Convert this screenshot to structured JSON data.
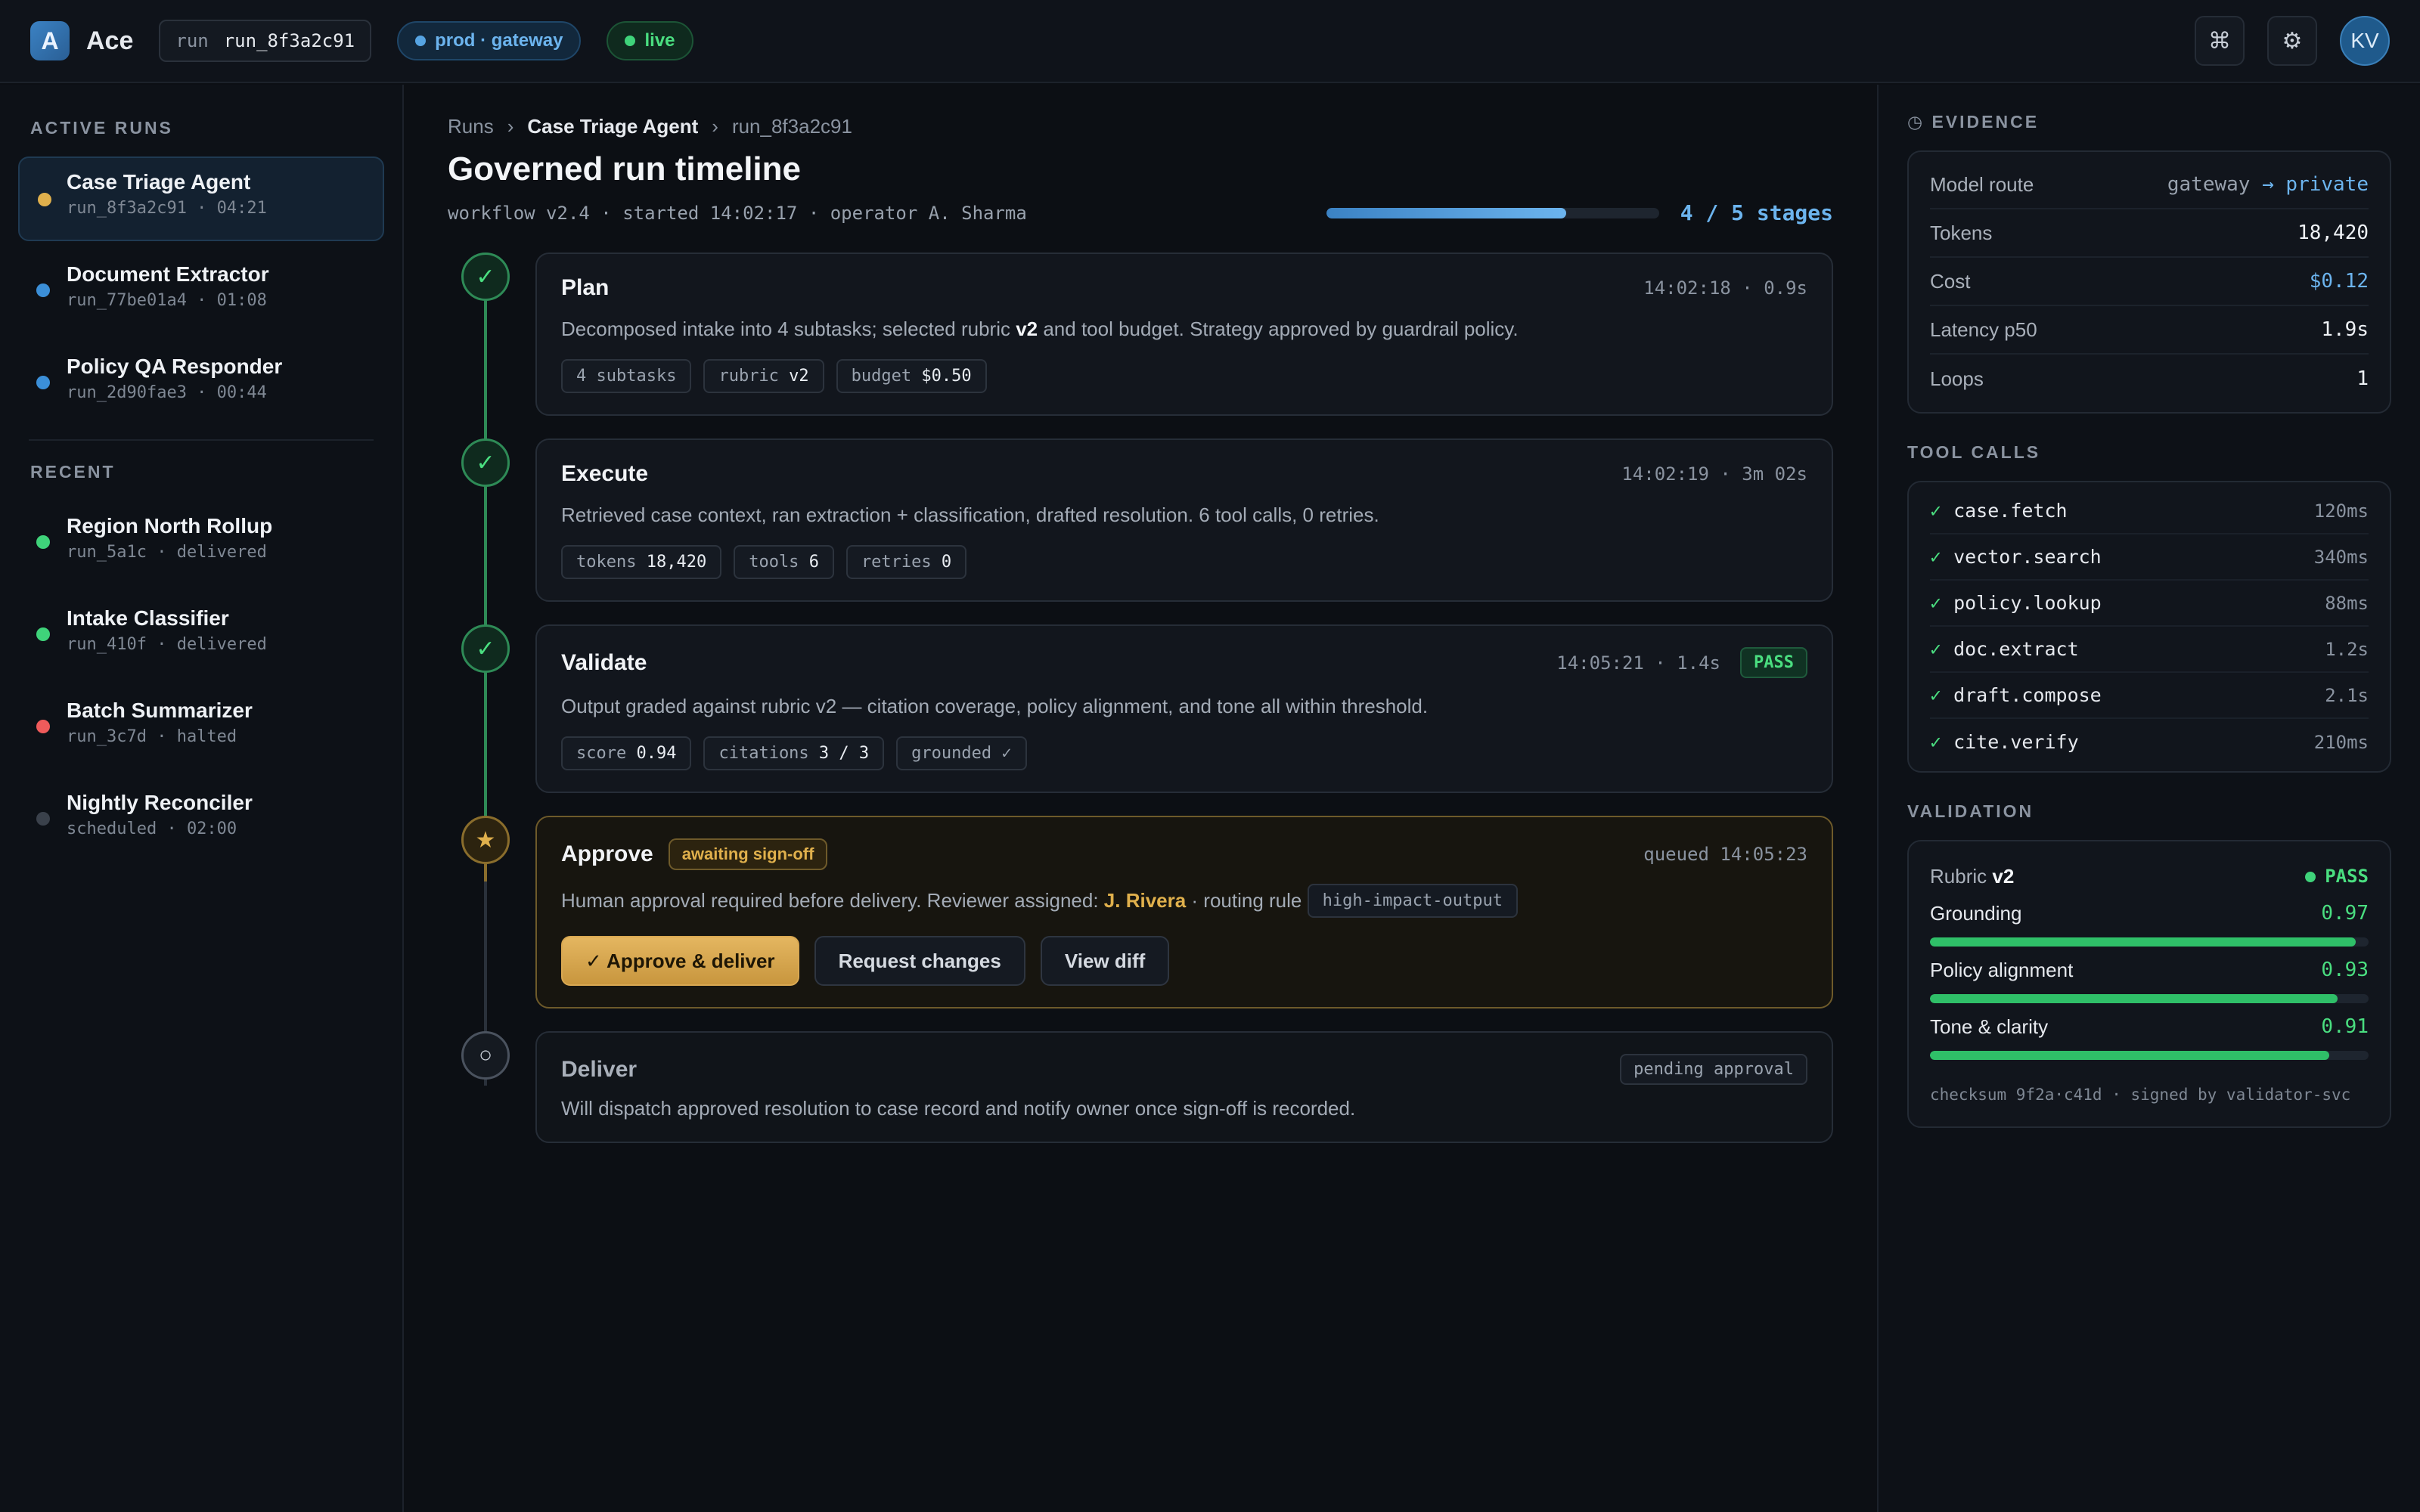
{
  "topbar": {
    "logo_letter": "A",
    "app_name": "Ace",
    "run_label": "run",
    "run_id": "run_8f3a2c91",
    "env_badge": "prod · gateway",
    "live_badge": "live",
    "command_icon": "⌘",
    "settings_icon": "⚙",
    "avatar_initials": "KV"
  },
  "sidebar": {
    "active_title": "ACTIVE RUNS",
    "recent_title": "RECENT",
    "active": [
      {
        "name": "Case Triage Agent",
        "sub": "run_8f3a2c91 · 04:21",
        "color": "#e0b04c"
      },
      {
        "name": "Document Extractor",
        "sub": "run_77be01a4 · 01:08",
        "color": "#3b8fd8"
      },
      {
        "name": "Policy QA Responder",
        "sub": "run_2d90fae3 · 00:44",
        "color": "#3b8fd8"
      }
    ],
    "recent": [
      {
        "name": "Region North Rollup",
        "sub": "run_5a1c · delivered",
        "color": "#3fd37a"
      },
      {
        "name": "Intake Classifier",
        "sub": "run_410f · delivered",
        "color": "#3fd37a"
      },
      {
        "name": "Batch Summarizer",
        "sub": "run_3c7d · halted",
        "color": "#ef5b5b"
      },
      {
        "name": "Nightly Reconciler",
        "sub": "scheduled · 02:00",
        "color": "#3a414b"
      }
    ]
  },
  "main": {
    "breadcrumb": {
      "root": "Runs",
      "agent": "Case Triage Agent",
      "run": "run_8f3a2c91",
      "sep": "›"
    },
    "title": "Governed run timeline",
    "meta": "workflow v2.4 · started 14:02:17 · operator A. Sharma",
    "progress": {
      "value": 0.72,
      "label": "4 / 5 stages"
    },
    "stages": {
      "plan": {
        "title": "Plan",
        "time": "14:02:18 · 0.9s",
        "desc_a": "Decomposed intake into 4 subtasks; selected rubric ",
        "desc_b": "v2",
        "desc_c": " and tool budget. Strategy approved by guardrail policy.",
        "tags": [
          {
            "k": "4 subtasks",
            "v": ""
          },
          {
            "k": "rubric ",
            "v": "v2"
          },
          {
            "k": "budget ",
            "v": "$0.50"
          }
        ],
        "icon": "✓"
      },
      "execute": {
        "title": "Execute",
        "time": "14:02:19 · 3m 02s",
        "desc": "Retrieved case context, ran extraction + classification, drafted resolution. 6 tool calls, 0 retries.",
        "tags": [
          {
            "k": "tokens ",
            "v": "18,420"
          },
          {
            "k": "tools ",
            "v": "6"
          },
          {
            "k": "retries ",
            "v": "0"
          }
        ],
        "icon": "✓"
      },
      "validate": {
        "title": "Validate",
        "time": "14:05:21 · 1.4s",
        "pass": "PASS",
        "desc": "Output graded against rubric v2 — citation coverage, policy alignment, and tone all within threshold.",
        "tags": [
          {
            "k": "score ",
            "v": "0.94"
          },
          {
            "k": "citations ",
            "v": "3 / 3"
          },
          {
            "k": "grounded ✓",
            "v": ""
          }
        ],
        "icon": "✓"
      },
      "approve": {
        "title": "Approve",
        "badge": "awaiting sign-off",
        "time": "queued 14:05:23",
        "desc_a": "Human approval required before delivery. Reviewer assigned: ",
        "reviewer": "J. Rivera",
        "desc_b": " · routing rule ",
        "rule": "high-impact-output",
        "btn_approve": "✓ Approve & deliver",
        "btn_request": "Request changes",
        "btn_diff": "View diff",
        "icon": "★"
      },
      "deliver": {
        "title": "Deliver",
        "status": "pending approval",
        "desc": "Will dispatch approved resolution to case record and notify owner once sign-off is recorded.",
        "icon": "○"
      }
    }
  },
  "right": {
    "evidence_title": "◷ EVIDENCE",
    "evidence": {
      "model_route_k": "Model route",
      "model_route_a": "gateway ",
      "model_route_b": "→ private",
      "tokens_k": "Tokens",
      "tokens_v": "18,420",
      "cost_k": "Cost",
      "cost_v": "$0.12",
      "latency_k": "Latency p50",
      "latency_v": "1.9s",
      "loops_k": "Loops",
      "loops_v": "1"
    },
    "tools_title": "TOOL CALLS",
    "tools": [
      {
        "name": "case.fetch",
        "ms": "120ms"
      },
      {
        "name": "vector.search",
        "ms": "340ms"
      },
      {
        "name": "policy.lookup",
        "ms": "88ms"
      },
      {
        "name": "doc.extract",
        "ms": "1.2s"
      },
      {
        "name": "draft.compose",
        "ms": "2.1s"
      },
      {
        "name": "cite.verify",
        "ms": "210ms"
      }
    ],
    "validation_title": "VALIDATION",
    "validation": {
      "rubric_a": "Rubric ",
      "rubric_b": "v2",
      "pass": "PASS",
      "metrics": [
        {
          "name": "Grounding",
          "value": "0.97",
          "frac": 0.97
        },
        {
          "name": "Policy alignment",
          "value": "0.93",
          "frac": 0.93
        },
        {
          "name": "Tone & clarity",
          "value": "0.91",
          "frac": 0.91
        }
      ],
      "checksum": "checksum 9f2a·c41d · signed by validator-svc"
    }
  }
}
